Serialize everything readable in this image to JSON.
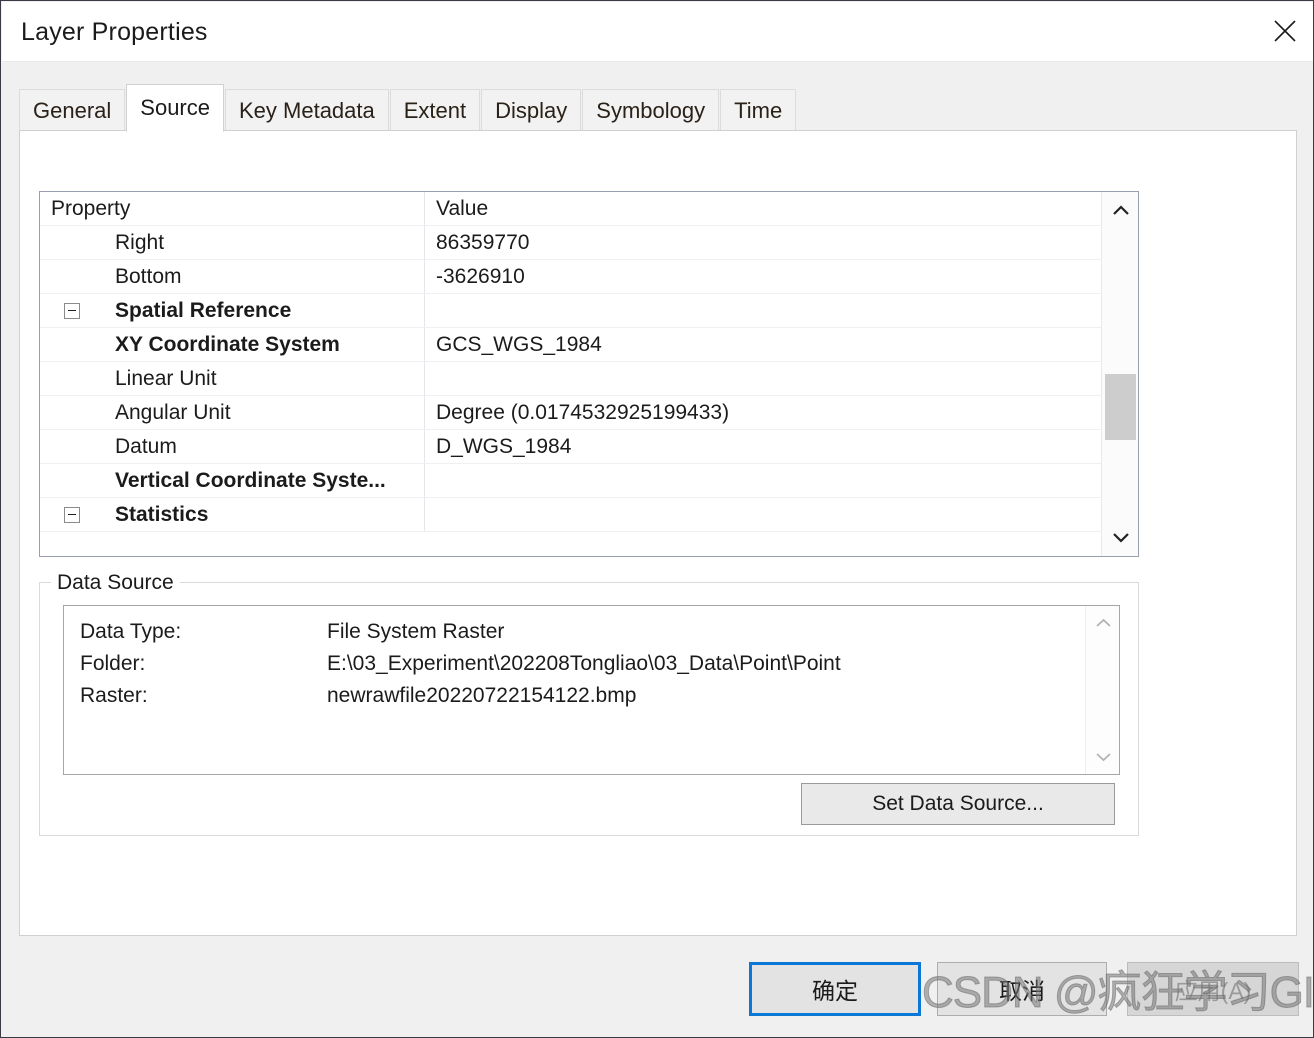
{
  "window": {
    "title": "Layer Properties",
    "close_icon": "close-icon"
  },
  "tabs": [
    {
      "label": "General",
      "active": false
    },
    {
      "label": "Source",
      "active": true
    },
    {
      "label": "Key Metadata",
      "active": false
    },
    {
      "label": "Extent",
      "active": false
    },
    {
      "label": "Display",
      "active": false
    },
    {
      "label": "Symbology",
      "active": false
    },
    {
      "label": "Time",
      "active": false
    }
  ],
  "property_table": {
    "columns": [
      "Property",
      "Value"
    ],
    "rows": [
      {
        "label": "Right",
        "value": "86359770",
        "indent": 1,
        "bold": false,
        "expander": false
      },
      {
        "label": "Bottom",
        "value": "-3626910",
        "indent": 1,
        "bold": false,
        "expander": false
      },
      {
        "label": "Spatial Reference",
        "value": "",
        "indent": 0,
        "bold": true,
        "expander": true
      },
      {
        "label": "XY Coordinate System",
        "value": "GCS_WGS_1984",
        "indent": 1,
        "bold": true,
        "expander": false
      },
      {
        "label": "Linear Unit",
        "value": "",
        "indent": 1,
        "bold": false,
        "expander": false
      },
      {
        "label": "Angular Unit",
        "value": "Degree (0.0174532925199433)",
        "indent": 1,
        "bold": false,
        "expander": false
      },
      {
        "label": "Datum",
        "value": "D_WGS_1984",
        "indent": 1,
        "bold": false,
        "expander": false
      },
      {
        "label": "Vertical Coordinate Syste...",
        "value": "",
        "indent": 1,
        "bold": true,
        "expander": false
      },
      {
        "label": "Statistics",
        "value": "",
        "indent": 0,
        "bold": true,
        "expander": true
      }
    ],
    "scrollbar": {
      "up_icon": "chevron-up-icon",
      "down_icon": "chevron-down-icon"
    }
  },
  "data_source": {
    "legend": "Data Source",
    "rows": [
      {
        "key": "Data Type:",
        "value": "File System Raster"
      },
      {
        "key": "Folder:",
        "value": "E:\\03_Experiment\\202208Tongliao\\03_Data\\Point\\Point"
      },
      {
        "key": "Raster:",
        "value": "newrawfile20220722154122.bmp"
      }
    ],
    "scrollbar": {
      "up_icon": "chevron-up-icon",
      "down_icon": "chevron-down-icon"
    },
    "set_data_source_label": "Set Data Source..."
  },
  "footer": {
    "ok_label": "确定",
    "cancel_label": "取消",
    "apply_label": "应用(A)"
  },
  "watermark": {
    "text": "CSDN @疯狂学习GIS"
  },
  "colors": {
    "accent_focus": "#0a78d4",
    "dialog_background": "#f0f0f0",
    "panel_background": "#ffffff",
    "table_border": "#9aa0b0",
    "scroll_thumb": "#cdcdcd"
  }
}
